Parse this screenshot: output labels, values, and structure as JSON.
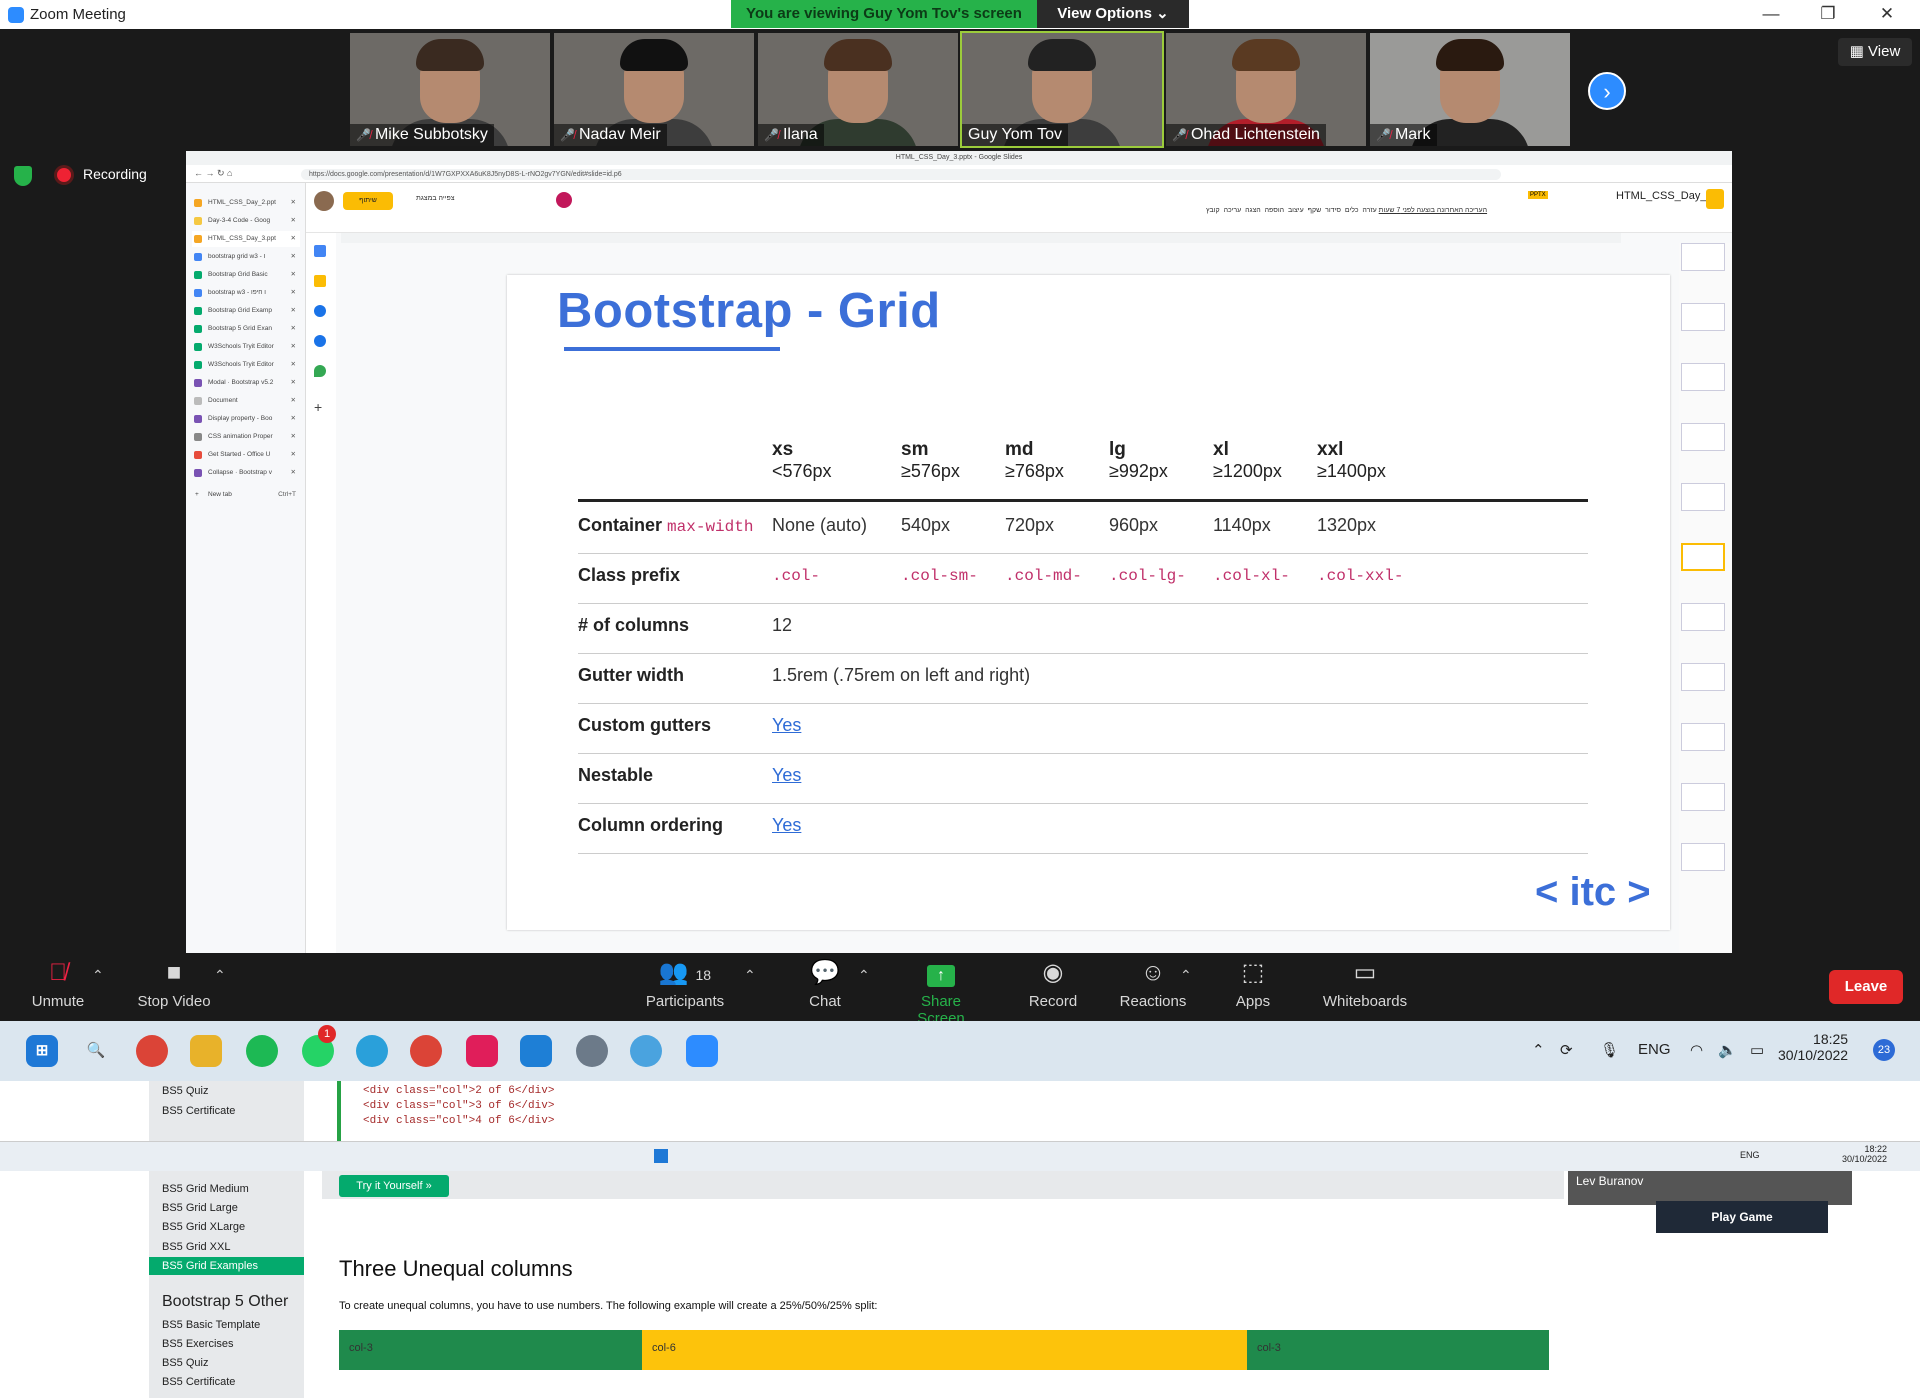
{
  "window": {
    "title": "Zoom Meeting",
    "minimize": "—",
    "restore": "❐",
    "close": "✕"
  },
  "banner": {
    "viewing": "You are viewing Guy Yom Tov's screen",
    "view_options": "View Options ⌄"
  },
  "view_button": "▦ View",
  "participants_gallery": [
    {
      "name": "Mike Subbotsky",
      "muted": true
    },
    {
      "name": "Nadav Meir",
      "muted": true
    },
    {
      "name": "Ilana",
      "muted": true
    },
    {
      "name": "Guy Yom Tov",
      "muted": false
    },
    {
      "name": "Ohad Lichtenstein",
      "muted": true
    },
    {
      "name": "Mark",
      "muted": true
    }
  ],
  "recording": {
    "label": "Recording"
  },
  "shared_screen": {
    "browser": {
      "window_title": "HTML_CSS_Day_3.pptx - Google Slides",
      "url": "https://docs.google.com/presentation/d/1W7GXPXXA6uK8J5nyD8S-L-rNO2gv7YGN/edit#slide=id.p6",
      "tabs": [
        "HTML_CSS_Day_2.ppt",
        "Day-3-4 Code - Goog",
        "HTML_CSS_Day_3.ppt",
        "bootstrap grid w3 - ו",
        "Bootstrap Grid Basic",
        "bootstrap w3 - ו חיפו",
        "Bootstrap Grid Examp",
        "Bootstrap 5 Grid Exan",
        "W3Schools Tryit Editor",
        "W3Schools Tryit Editor",
        "Modal · Bootstrap v5.2",
        "Document",
        "Display property - Boo",
        "CSS animation Proper",
        "Get Started - Office U",
        "Collapse · Bootstrap v"
      ],
      "new_tab": "New tab",
      "new_tab_shortcut": "Ctrl+T"
    },
    "slides_app": {
      "doc_title": "HTML_CSS_Day_3",
      "badge": "PPTX",
      "share_label": "שיתוף",
      "present_label": "צפייה במצגת",
      "last_edit": "העריכה האחרונה בוצעה לפני 7 שעות",
      "menu": [
        "קובץ",
        "עריכה",
        "הצגה",
        "הוספה",
        "עיצוב",
        "שקף",
        "סידור",
        "כלים",
        "עזרה"
      ]
    },
    "slide": {
      "title": "Bootstrap - Grid",
      "logo": "< itc >",
      "columns": [
        {
          "name": "xs",
          "range": "<576px"
        },
        {
          "name": "sm",
          "range": "≥576px"
        },
        {
          "name": "md",
          "range": "≥768px"
        },
        {
          "name": "lg",
          "range": "≥992px"
        },
        {
          "name": "xl",
          "range": "≥1200px"
        },
        {
          "name": "xxl",
          "range": "≥1400px"
        }
      ],
      "rows": {
        "container": {
          "label": "Container",
          "code": "max-width",
          "values": [
            "None (auto)",
            "540px",
            "720px",
            "960px",
            "1140px",
            "1320px"
          ]
        },
        "class_prefix": {
          "label": "Class prefix",
          "values": [
            ".col-",
            ".col-sm-",
            ".col-md-",
            ".col-lg-",
            ".col-xl-",
            ".col-xxl-"
          ]
        },
        "num_columns": {
          "label": "# of columns",
          "value": "12"
        },
        "gutter_width": {
          "label": "Gutter width",
          "value": "1.5rem (.75rem on left and right)"
        },
        "custom_gutters": {
          "label": "Custom gutters",
          "value": "Yes"
        },
        "nestable": {
          "label": "Nestable",
          "value": "Yes"
        },
        "column_ordering": {
          "label": "Column ordering",
          "value": "Yes"
        }
      }
    }
  },
  "controls": {
    "unmute": "Unmute",
    "stop_video": "Stop Video",
    "participants": "Participants",
    "participants_count": "18",
    "chat": "Chat",
    "share_screen": "Share Screen",
    "record": "Record",
    "reactions": "Reactions",
    "apps": "Apps",
    "whiteboards": "Whiteboards",
    "leave": "Leave"
  },
  "taskbar": {
    "language": "ENG",
    "time": "18:25",
    "date": "30/10/2022",
    "notifications": "23",
    "whatsapp_badge": "1"
  },
  "background_page": {
    "nav_top": [
      "BS5 Quiz",
      "BS5 Certificate"
    ],
    "code_lines": [
      "<div class=\"col\">2 of 6</div>",
      "<div class=\"col\">3 of 6</div>",
      "<div class=\"col\">4 of 6</div>"
    ],
    "inner_taskbar": {
      "language": "ENG",
      "time": "18:22",
      "date": "30/10/2022"
    },
    "try_button": "Try it Yourself »",
    "nav_bottom": [
      "BS5 Grid Medium",
      "BS5 Grid Large",
      "BS5 Grid XLarge",
      "BS5 Grid XXL",
      "BS5 Grid Examples"
    ],
    "section_other": "Bootstrap 5 Other",
    "nav_other": [
      "BS5 Basic Template",
      "BS5 Exercises",
      "BS5 Quiz",
      "BS5 Certificate"
    ],
    "heading": "Three Unequal columns",
    "paragraph": "To create unequal columns, you have to use numbers. The following example will create a 25%/50%/25% split:",
    "col_labels": [
      "col-3",
      "col-6",
      "col-3"
    ],
    "side_tile_name": "Lev Buranov",
    "play_game": "Play Game"
  }
}
